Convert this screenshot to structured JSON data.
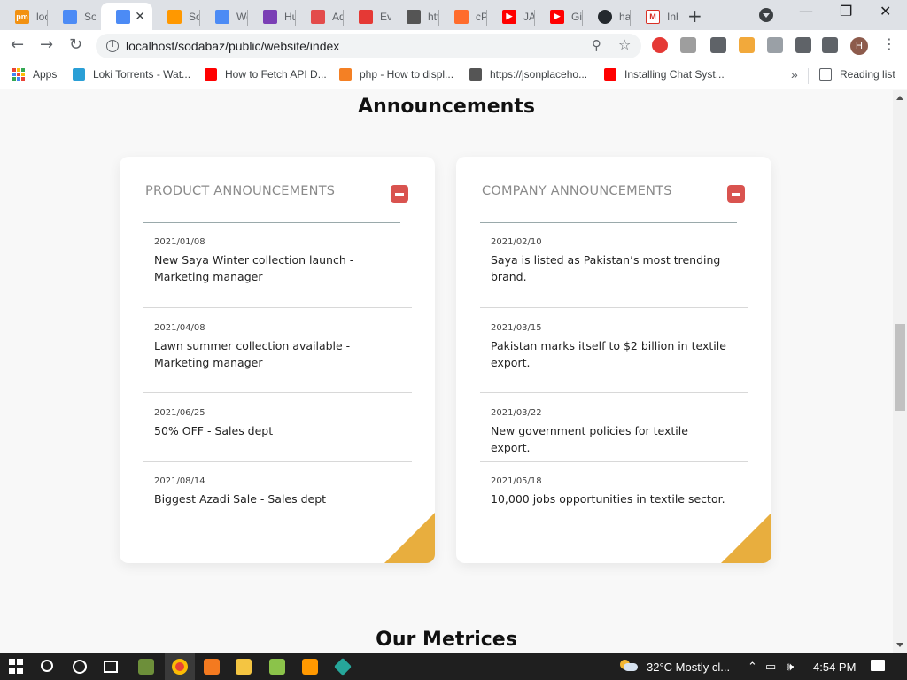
{
  "browser": {
    "tabs": [
      {
        "label": "loc",
        "icon": "phpmyadmin-icon",
        "color": "#f29111"
      },
      {
        "label": "So",
        "icon": "site-icon",
        "color": "#4c8bf5"
      },
      {
        "label": "",
        "icon": "site-icon",
        "color": "#4c8bf5",
        "active": true
      },
      {
        "label": "So",
        "icon": "sublime-icon",
        "color": "#ff9800"
      },
      {
        "label": "We",
        "icon": "site-icon",
        "color": "#4c8bf5"
      },
      {
        "label": "Hu",
        "icon": "shirt-icon",
        "color": "#7b3fb5"
      },
      {
        "label": "Ad",
        "icon": "shield-icon",
        "color": "#e34b4b"
      },
      {
        "label": "Ev",
        "icon": "event-icon",
        "color": "#e53935"
      },
      {
        "label": "htt",
        "icon": "api-icon",
        "color": "#555555"
      },
      {
        "label": "cPa",
        "icon": "cpanel-icon",
        "color": "#ff6c2c"
      },
      {
        "label": "JA",
        "icon": "youtube-icon",
        "color": "#ff0000"
      },
      {
        "label": "Git",
        "icon": "youtube-icon",
        "color": "#ff0000"
      },
      {
        "label": "ha",
        "icon": "github-icon",
        "color": "#24292e"
      },
      {
        "label": "Inb",
        "icon": "gmail-icon",
        "color": "#d93025"
      }
    ],
    "active_tab_close": "✕",
    "new_tab": "+",
    "url": "localhost/sodabaz/public/website/index",
    "bookmarks": [
      {
        "label": "Apps",
        "icon": "apps-icon"
      },
      {
        "label": "Loki Torrents - Wat...",
        "icon": "torrent-icon",
        "color": "#2a9fd6"
      },
      {
        "label": "How to Fetch API D...",
        "icon": "youtube-icon",
        "color": "#ff0000"
      },
      {
        "label": "php - How to displ...",
        "icon": "stackoverflow-icon",
        "color": "#f48024"
      },
      {
        "label": "https://jsonplaceho...",
        "icon": "api-icon",
        "color": "#555555"
      },
      {
        "label": "Installing Chat Syst...",
        "icon": "youtube-icon",
        "color": "#ff0000"
      }
    ],
    "bookmarks_more": "»",
    "reading_list": "Reading list",
    "profile_initial": "H"
  },
  "page": {
    "title": "Announcements",
    "next_section_title": "Our Metrices",
    "accent_color": "#e8ae3e",
    "collapse_color": "#d9534f",
    "cards": [
      {
        "heading": "PRODUCT ANNOUNCEMENTS",
        "items": [
          {
            "date": "2021/01/08",
            "text": "New Saya Winter collection launch - Marketing manager"
          },
          {
            "date": "2021/04/08",
            "text": "Lawn summer collection available - Marketing manager"
          },
          {
            "date": "2021/06/25",
            "text": "50% OFF - Sales dept"
          },
          {
            "date": "2021/08/14",
            "text": "Biggest Azadi Sale - Sales dept"
          }
        ]
      },
      {
        "heading": "COMPANY ANNOUNCEMENTS",
        "items": [
          {
            "date": "2021/02/10",
            "text": "Saya is listed as Pakistan’s most trending brand."
          },
          {
            "date": "2021/03/15",
            "text": "Pakistan marks itself to $2 billion in textile export."
          },
          {
            "date": "2021/03/22",
            "text": "New government policies for textile export."
          },
          {
            "date": "2021/05/18",
            "text": "10,000 jobs opportunities in textile sector."
          }
        ]
      }
    ]
  },
  "taskbar": {
    "weather": "32°C  Mostly cl...",
    "time": "4:54 PM"
  }
}
